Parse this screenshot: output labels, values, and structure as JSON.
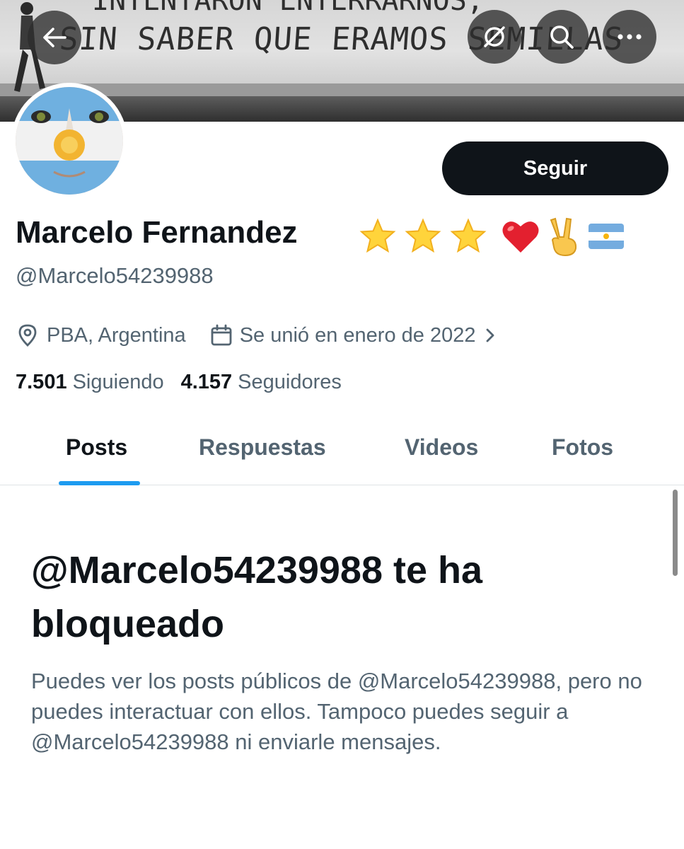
{
  "banner": {
    "graffiti_line1": "INTENTARON ENTERRARNOS,",
    "graffiti_line2": "SIN SABER QUE ERAMOS SEMILLAS"
  },
  "header": {
    "back_icon": "arrow-left-icon",
    "media_off_icon": "image-off-icon",
    "search_icon": "search-icon",
    "more_icon": "more-horizontal-icon"
  },
  "profile": {
    "display_name": "Marcelo Fernandez",
    "name_emojis": [
      "⭐",
      "⭐",
      "⭐",
      "❤️",
      "✌️",
      "🇦🇷"
    ],
    "handle": "@Marcelo54239988",
    "location": "PBA, Argentina",
    "joined": "Se unió en enero de 2022",
    "follow_label": "Seguir",
    "following_count": "7.501",
    "following_label": "Siguiendo",
    "followers_count": "4.157",
    "followers_label": "Seguidores"
  },
  "tabs": [
    {
      "label": "Posts",
      "active": true
    },
    {
      "label": "Respuestas",
      "active": false
    },
    {
      "label": "Videos",
      "active": false
    },
    {
      "label": "Fotos",
      "active": false
    }
  ],
  "blocked": {
    "title": "@Marcelo54239988 te ha bloqueado",
    "body": "Puedes ver los posts públicos de @Marcelo54239988, pero no puedes interactuar con ellos. Tampoco puedes seguir a @Marcelo54239988 ni enviarle mensajes."
  },
  "colors": {
    "text_primary": "#0f1419",
    "text_secondary": "#536471",
    "accent": "#1d9bf0",
    "follow_bg": "#0f1419"
  }
}
